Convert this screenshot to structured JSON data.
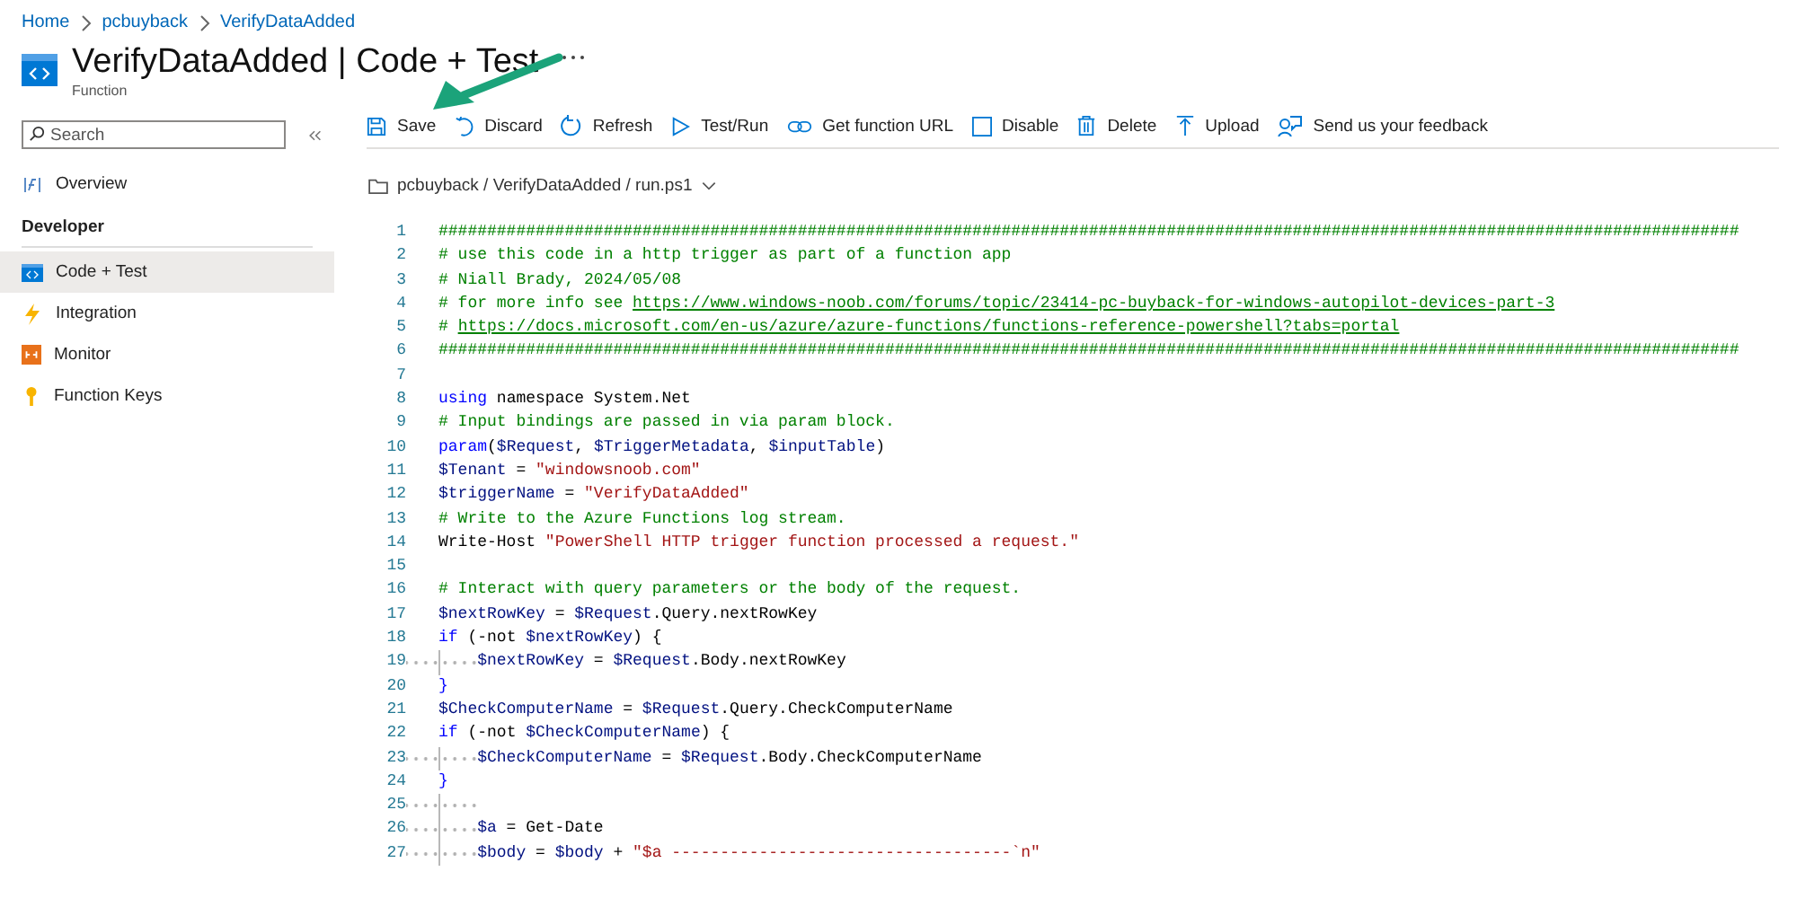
{
  "breadcrumb": [
    {
      "label": "Home"
    },
    {
      "label": "pcbuyback"
    },
    {
      "label": "VerifyDataAdded"
    }
  ],
  "title": "VerifyDataAdded | Code + Test",
  "subtitle": "Function",
  "search": {
    "placeholder": "Search"
  },
  "sidebar": {
    "items": [
      {
        "kind": "item",
        "label": "Overview",
        "selected": false
      },
      {
        "kind": "header",
        "label": "Developer"
      },
      {
        "kind": "item",
        "label": "Code + Test",
        "selected": true
      },
      {
        "kind": "item",
        "label": "Integration",
        "selected": false
      },
      {
        "kind": "item",
        "label": "Monitor",
        "selected": false
      },
      {
        "kind": "item",
        "label": "Function Keys",
        "selected": false
      }
    ]
  },
  "toolbar": [
    {
      "label": "Save"
    },
    {
      "label": "Discard"
    },
    {
      "label": "Refresh"
    },
    {
      "label": "Test/Run"
    },
    {
      "label": "Get function URL"
    },
    {
      "label": "Disable"
    },
    {
      "label": "Delete"
    },
    {
      "label": "Upload"
    },
    {
      "label": "Send us your feedback"
    }
  ],
  "file_path": "pcbuyback / VerifyDataAdded / run.ps1",
  "code_lines": [
    {
      "number": "1",
      "indented": false,
      "tokens": [
        {
          "kind": "comment",
          "text": "######################################################################################################################################"
        }
      ]
    },
    {
      "number": "2",
      "indented": false,
      "tokens": [
        {
          "kind": "comment",
          "text": "# use this code in a http trigger as part of a function app"
        }
      ]
    },
    {
      "number": "3",
      "indented": false,
      "tokens": [
        {
          "kind": "comment",
          "text": "# Niall Brady, 2024/05/08"
        }
      ]
    },
    {
      "number": "4",
      "indented": false,
      "tokens": [
        {
          "kind": "comment",
          "text": "# for more info see "
        },
        {
          "kind": "link",
          "text": "https://www.windows-noob.com/forums/topic/23414-pc-buyback-for-windows-autopilot-devices-part-3"
        }
      ]
    },
    {
      "number": "5",
      "indented": false,
      "tokens": [
        {
          "kind": "comment",
          "text": "# "
        },
        {
          "kind": "link",
          "text": "https://docs.microsoft.com/en-us/azure/azure-functions/functions-reference-powershell?tabs=portal"
        }
      ]
    },
    {
      "number": "6",
      "indented": false,
      "tokens": [
        {
          "kind": "comment",
          "text": "######################################################################################################################################"
        }
      ]
    },
    {
      "number": "7",
      "indented": false
    },
    {
      "number": "8",
      "indented": false,
      "tokens": [
        {
          "kind": "keyword",
          "text": "using"
        },
        {
          "kind": "plain",
          "text": " namespace System.Net"
        }
      ]
    },
    {
      "number": "9",
      "indented": false,
      "tokens": [
        {
          "kind": "comment",
          "text": "# Input bindings are passed in via param block."
        }
      ]
    },
    {
      "number": "10",
      "indented": false,
      "tokens": [
        {
          "kind": "keyword",
          "text": "param"
        },
        {
          "kind": "plain",
          "text": "("
        },
        {
          "kind": "variable",
          "text": "$Request"
        },
        {
          "kind": "plain",
          "text": ", "
        },
        {
          "kind": "variable",
          "text": "$TriggerMetadata"
        },
        {
          "kind": "plain",
          "text": ", "
        },
        {
          "kind": "variable",
          "text": "$inputTable"
        },
        {
          "kind": "plain",
          "text": ")"
        }
      ]
    },
    {
      "number": "11",
      "indented": false,
      "tokens": [
        {
          "kind": "variable",
          "text": "$Tenant"
        },
        {
          "kind": "plain",
          "text": " = "
        },
        {
          "kind": "string",
          "text": "\"windowsnoob.com\""
        }
      ]
    },
    {
      "number": "12",
      "indented": false,
      "tokens": [
        {
          "kind": "variable",
          "text": "$triggerName"
        },
        {
          "kind": "plain",
          "text": " = "
        },
        {
          "kind": "string",
          "text": "\"VerifyDataAdded\""
        }
      ]
    },
    {
      "number": "13",
      "indented": false,
      "tokens": [
        {
          "kind": "comment",
          "text": "# Write to the Azure Functions log stream."
        }
      ]
    },
    {
      "number": "14",
      "indented": false,
      "tokens": [
        {
          "kind": "plain",
          "text": "Write-Host "
        },
        {
          "kind": "string",
          "text": "\"PowerShell HTTP trigger function processed a request.\""
        }
      ]
    },
    {
      "number": "15",
      "indented": false
    },
    {
      "number": "16",
      "indented": false,
      "tokens": [
        {
          "kind": "comment",
          "text": "# Interact with query parameters or the body of the request."
        }
      ]
    },
    {
      "number": "17",
      "indented": false,
      "tokens": [
        {
          "kind": "variable",
          "text": "$nextRowKey"
        },
        {
          "kind": "plain",
          "text": " = "
        },
        {
          "kind": "variable",
          "text": "$Request"
        },
        {
          "kind": "plain",
          "text": ".Query.nextRowKey"
        }
      ]
    },
    {
      "number": "18",
      "indented": false,
      "tokens": [
        {
          "kind": "keyword",
          "text": "if"
        },
        {
          "kind": "plain",
          "text": " (-not "
        },
        {
          "kind": "variable",
          "text": "$nextRowKey"
        },
        {
          "kind": "plain",
          "text": ") {"
        }
      ]
    },
    {
      "number": "19",
      "indented": true,
      "tokens": [
        {
          "kind": "variable",
          "text": "$nextRowKey"
        },
        {
          "kind": "plain",
          "text": " = "
        },
        {
          "kind": "variable",
          "text": "$Request"
        },
        {
          "kind": "plain",
          "text": ".Body.nextRowKey"
        }
      ]
    },
    {
      "number": "20",
      "indented": false,
      "tokens": [
        {
          "kind": "keyword",
          "text": "}"
        }
      ]
    },
    {
      "number": "21",
      "indented": false,
      "tokens": [
        {
          "kind": "variable",
          "text": "$CheckComputerName"
        },
        {
          "kind": "plain",
          "text": " = "
        },
        {
          "kind": "variable",
          "text": "$Request"
        },
        {
          "kind": "plain",
          "text": ".Query.CheckComputerName"
        }
      ]
    },
    {
      "number": "22",
      "indented": false,
      "tokens": [
        {
          "kind": "keyword",
          "text": "if"
        },
        {
          "kind": "plain",
          "text": " (-not "
        },
        {
          "kind": "variable",
          "text": "$CheckComputerName"
        },
        {
          "kind": "plain",
          "text": ") {"
        }
      ]
    },
    {
      "number": "23",
      "indented": true,
      "tokens": [
        {
          "kind": "variable",
          "text": "$CheckComputerName"
        },
        {
          "kind": "plain",
          "text": " = "
        },
        {
          "kind": "variable",
          "text": "$Request"
        },
        {
          "kind": "plain",
          "text": ".Body.CheckComputerName"
        }
      ]
    },
    {
      "number": "24",
      "indented": false,
      "tokens": [
        {
          "kind": "keyword",
          "text": "}"
        }
      ]
    },
    {
      "number": "25",
      "indented": true
    },
    {
      "number": "26",
      "indented": true,
      "tokens": [
        {
          "kind": "variable",
          "text": "$a"
        },
        {
          "kind": "plain",
          "text": " = Get-Date"
        }
      ]
    },
    {
      "number": "27",
      "indented": true,
      "tokens": [
        {
          "kind": "variable",
          "text": "$body"
        },
        {
          "kind": "plain",
          "text": " = "
        },
        {
          "kind": "variable",
          "text": "$body"
        },
        {
          "kind": "plain",
          "text": " + "
        },
        {
          "kind": "string",
          "text": "\"$a -----------------------------------`n\""
        }
      ]
    }
  ]
}
